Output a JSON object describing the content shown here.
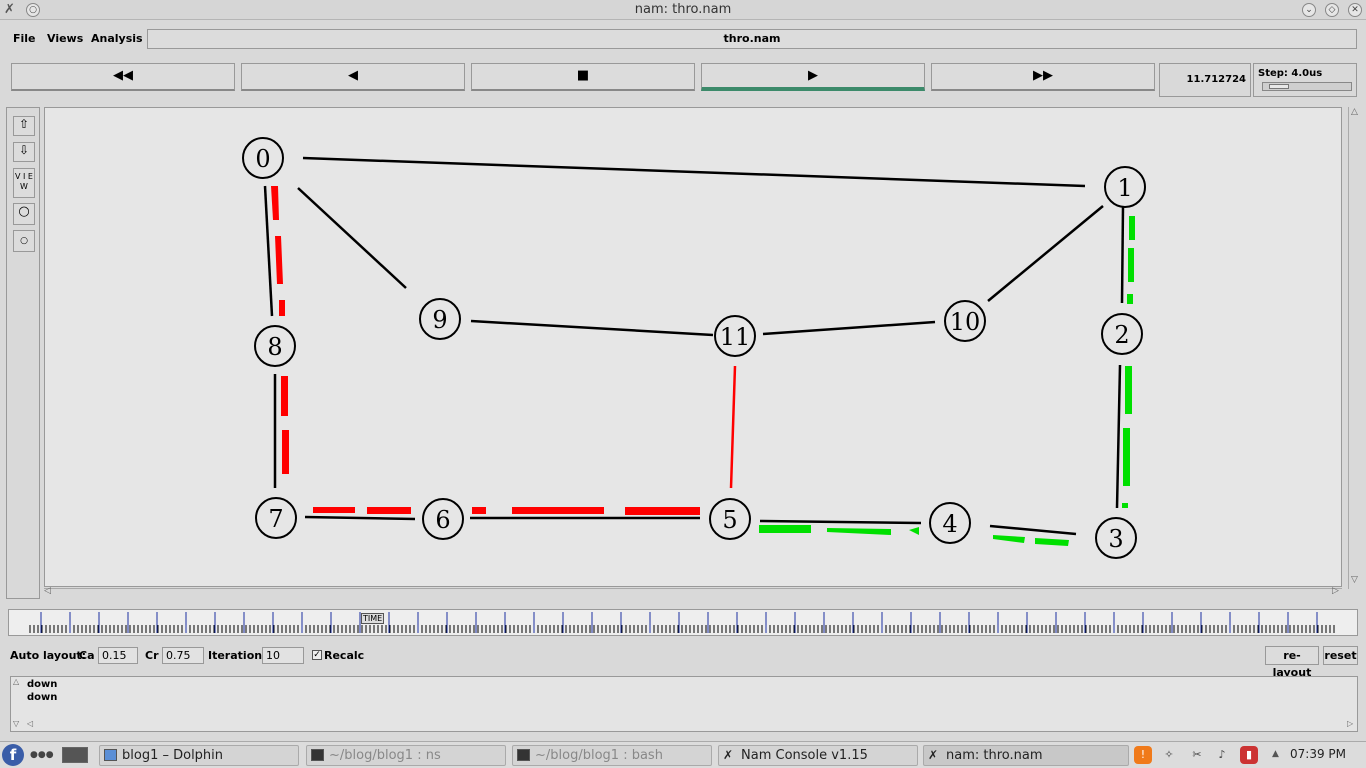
{
  "window": {
    "title": "nam: thro.nam"
  },
  "menu": {
    "file": "File",
    "views": "Views",
    "analysis": "Analysis",
    "filename": "thro.nam"
  },
  "playback": {
    "rewind": "◀◀",
    "back": "◀",
    "stop": "■",
    "play": "▶",
    "fastforward": "▶▶",
    "time": "11.712724",
    "step": "Step: 4.0us"
  },
  "tools": {
    "view_label": "V I E W"
  },
  "timebar": {
    "label": "TIME"
  },
  "network": {
    "nodes": [
      "0",
      "1",
      "2",
      "3",
      "4",
      "5",
      "6",
      "7",
      "8",
      "9",
      "10",
      "11"
    ],
    "packet_colors": {
      "red": "#ff0000",
      "green": "#00e000"
    }
  },
  "autolayout": {
    "label": "Auto layout:",
    "ca_label": "Ca",
    "ca_value": "0.15",
    "cr_label": "Cr",
    "cr_value": "0.75",
    "iter_label": "Iterations",
    "iter_value": "10",
    "recalc_label": "Recalc",
    "recalc_checked": true,
    "relayout": "re-layout",
    "reset": "reset"
  },
  "console": {
    "lines": [
      "down",
      "down"
    ]
  },
  "taskbar": {
    "tasks": [
      {
        "label": "blog1 – Dolphin"
      },
      {
        "label": "~/blog/blog1 : ns"
      },
      {
        "label": "~/blog/blog1 : bash"
      },
      {
        "label": "Nam Console v1.15"
      },
      {
        "label": "nam: thro.nam"
      }
    ],
    "clock": "07:39 PM"
  }
}
